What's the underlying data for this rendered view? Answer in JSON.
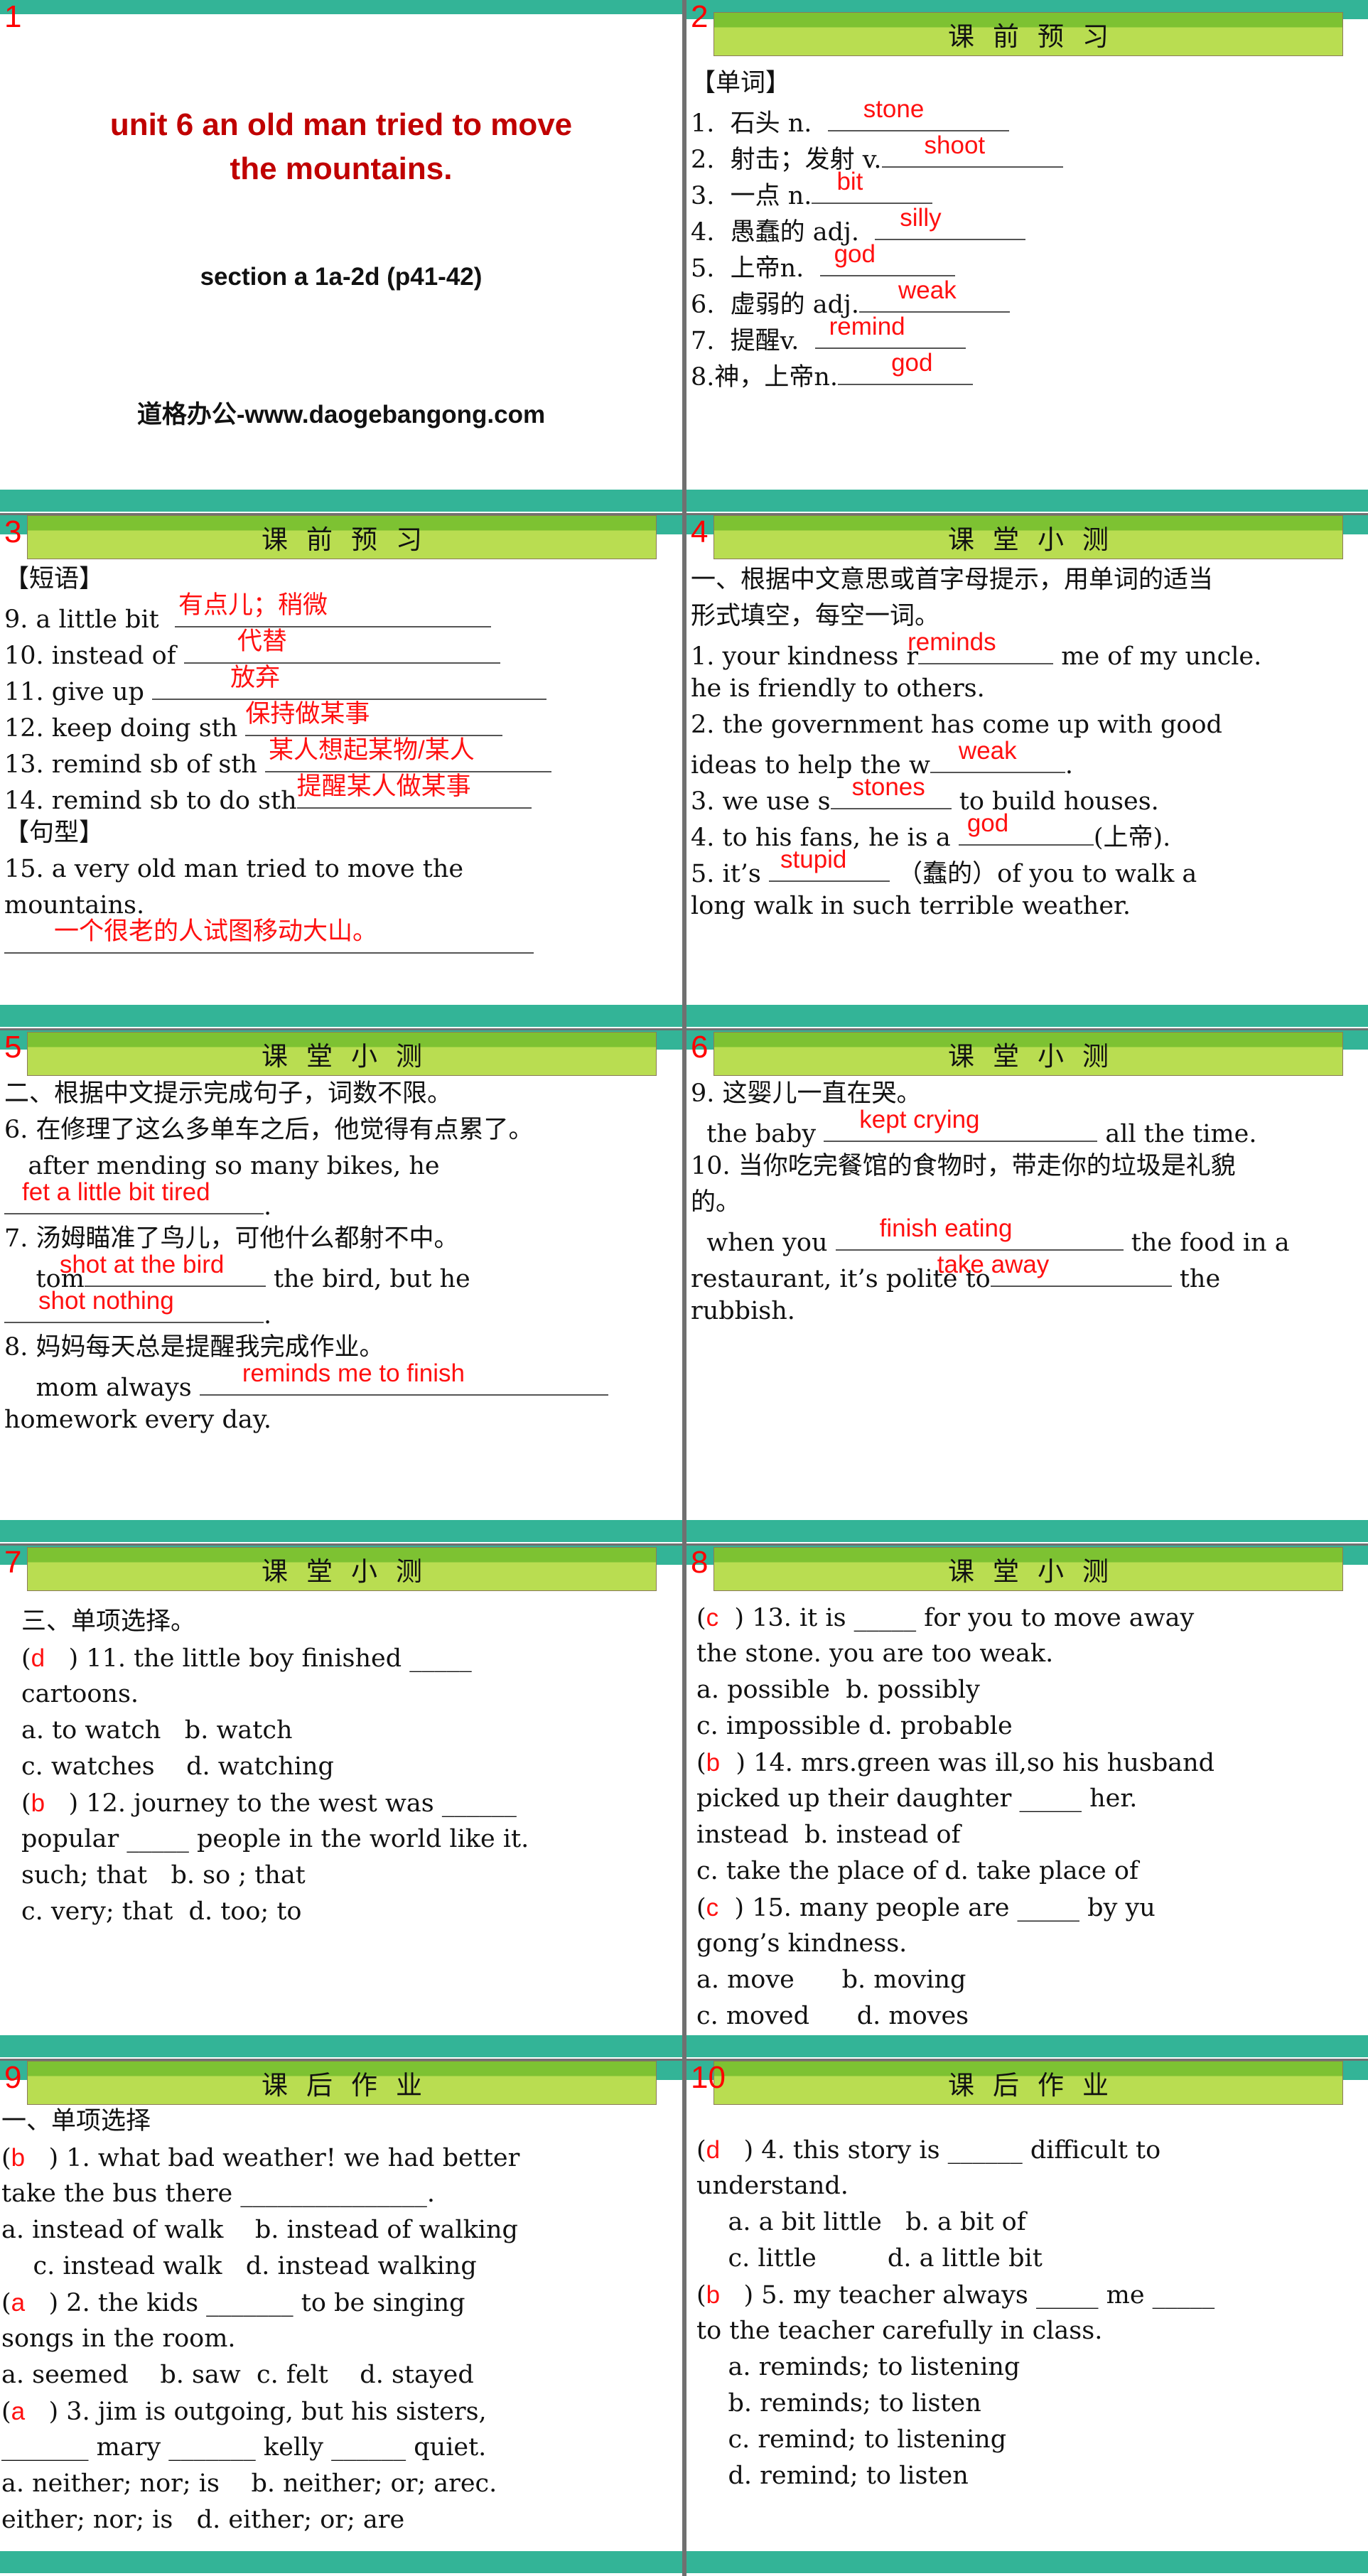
{
  "colors": {
    "teal": "#33b497",
    "green_dark": "#7dc232",
    "green_light": "#b9dd51",
    "answer_red": "#ff1010",
    "title_red": "#c00000",
    "divider_gray": "#707070"
  },
  "slides": [
    {
      "number": "1",
      "title_line1": "unit 6  an old man tried to move",
      "title_line2": "the mountains.",
      "subtitle": "section a 1a-2d (p41-42)",
      "site": "道格办公-www.daogebangong.com"
    },
    {
      "number": "2",
      "header": "课前预习",
      "section": "【单词】",
      "items": [
        {
          "prefix": "1.  石头 n.  ",
          "answer": "stone",
          "suffix": ""
        },
        {
          "prefix": "2.  射击；发射 v.",
          "answer": "shoot",
          "suffix": ""
        },
        {
          "prefix": "3.  一点 n.",
          "answer": "bit",
          "suffix": ""
        },
        {
          "prefix": "4.  愚蠢的 adj.  ",
          "answer": "silly",
          "suffix": ""
        },
        {
          "prefix": "5.  上帝n.  ",
          "answer": "god",
          "suffix": ""
        },
        {
          "prefix": "6.  虚弱的 adj.",
          "answer": "weak",
          "suffix": ""
        },
        {
          "prefix": "7.  提醒v.  ",
          "answer": "remind",
          "suffix": ""
        },
        {
          "prefix": "8.神，上帝n.",
          "answer": "god",
          "suffix": ""
        }
      ]
    },
    {
      "number": "3",
      "header": "课前预习",
      "section_phrases": "【短语】",
      "items": [
        {
          "prefix": "9. a little bit  ",
          "answer": "有点儿；稍微"
        },
        {
          "prefix": "10. instead of ",
          "answer": "代替"
        },
        {
          "prefix": "11. give up ",
          "answer": "放弃"
        },
        {
          "prefix": "12. keep doing sth ",
          "answer": "保持做某事"
        },
        {
          "prefix": "13. remind sb of sth ",
          "answer": "某人想起某物/某人"
        },
        {
          "prefix": "14. remind sb to do sth",
          "answer": "提醒某人做某事"
        }
      ],
      "section_sentence": "【句型】",
      "sentence_line1": "15. a very old man tried to move the",
      "sentence_line2": "mountains.",
      "sentence_answer": "一个很老的人试图移动大山。"
    },
    {
      "number": "4",
      "header": "课堂小测",
      "instruction_line1": "一、根据中文意思或首字母提示，用单词的适当",
      "instruction_line2": "形式填空，每空一词。",
      "q1_a": "1. your kindness r",
      "q1_answer": "reminds",
      "q1_b": " me of my uncle.",
      "q1_c": "he is friendly to others.",
      "q2_a": "2. the government has come up with good",
      "q2_b": "ideas to help the w",
      "q2_answer": "weak",
      "q2_c": ".",
      "q3_a": "3. we use s",
      "q3_answer": "stones",
      "q3_b": " to build houses.",
      "q4_a": "4. to his fans, he is a ",
      "q4_answer": "god",
      "q4_b": "(上帝).",
      "q5_a": "5. it’s ",
      "q5_answer": "stupid",
      "q5_b": " （蠢的）of you to walk a",
      "q5_c": "long walk in such terrible weather."
    },
    {
      "number": "5",
      "header": "课堂小测",
      "instruction": "二、根据中文提示完成句子，词数不限。",
      "q6_cn": "6. 在修理了这么多单车之后，他觉得有点累了。",
      "q6_en": "   after mending so many bikes, he",
      "q6_answer": "fet a little bit tired",
      "q6_end": ".",
      "q7_cn": "7. 汤姆瞄准了鸟儿，可他什么都射不中。",
      "q7_a": "    tom",
      "q7_answer1": "shot at the bird",
      "q7_b": " the bird, but he",
      "q7_answer2": "shot nothing",
      "q7_end": ".",
      "q8_cn": "8. 妈妈每天总是提醒我完成作业。",
      "q8_a": "    mom always ",
      "q8_answer": "reminds me to finish",
      "q8_b": "homework every day."
    },
    {
      "number": "6",
      "header": "课堂小测",
      "q9_cn": "9. 这婴儿一直在哭。",
      "q9_a": "  the baby ",
      "q9_answer": "kept crying",
      "q9_b": " all the time.",
      "q10_cn_line1": "10. 当你吃完餐馆的食物时，带走你的垃圾是礼貌",
      "q10_cn_line2": "的。",
      "q10_a": "  when you ",
      "q10_answer1": "finish eating",
      "q10_b": " the food in a",
      "q10_c": "restaurant, it’s polite to",
      "q10_answer2": "take away",
      "q10_d": " the",
      "q10_e": "rubbish."
    },
    {
      "number": "7",
      "header": "课堂小测",
      "instruction": "三、单项选择。",
      "questions": [
        {
          "answer": "d",
          "stem_line1": " ) 11. the little boy finished _____",
          "stem_line2": "cartoons.",
          "options_line1": "a. to watch   b. watch",
          "options_line2": "c. watches    d. watching"
        },
        {
          "answer": "b",
          "stem_line1": " ) 12. journey to the west was ______",
          "stem_line2": "popular _____ people in the world like it.",
          "options_line1": "such; that   b. so ; that",
          "options_line2": "c. very; that  d. too; to"
        }
      ]
    },
    {
      "number": "8",
      "header": "课堂小测",
      "questions": [
        {
          "answer": "c",
          "stem_line1": " ) 13. it is _____ for you to move away",
          "stem_line2": "the stone. you are too weak.",
          "options_line1": "a. possible  b. possibly",
          "options_line2": "c. impossible d. probable"
        },
        {
          "answer": "b",
          "stem_line1": " ) 14. mrs.green was ill,so his husband",
          "stem_line2": "picked up their daughter _____ her.",
          "options_line1": "instead  b. instead of",
          "options_line2": "c. take the place of d. take place of"
        },
        {
          "answer": "c",
          "stem_line1": " ) 15. many people are _____ by yu",
          "stem_line2": "gong’s kindness.",
          "options_line1": "a. move      b. moving",
          "options_line2": "c. moved      d. moves"
        }
      ]
    },
    {
      "number": "9",
      "header": "课后作业",
      "instruction": "一、单项选择",
      "lines": [
        {
          "answer": "b",
          "text": " ) 1. what bad weather! we had better"
        },
        {
          "answer": "",
          "text": "take the bus there _______________."
        },
        {
          "answer": "",
          "text": "a. instead of walk    b. instead of walking"
        },
        {
          "answer": "",
          "text": "    c. instead walk   d. instead walking"
        },
        {
          "answer": "a",
          "text": " ) 2. the kids _______ to be singing"
        },
        {
          "answer": "",
          "text": "songs in the room."
        },
        {
          "answer": "",
          "text": "a. seemed    b. saw  c. felt    d. stayed"
        },
        {
          "answer": "a",
          "text": " ) 3. jim is outgoing, but his sisters,"
        },
        {
          "answer": "",
          "text": "_______ mary _______ kelly ______ quiet."
        },
        {
          "answer": "",
          "text": "a. neither; nor; is    b. neither; or; arec."
        },
        {
          "answer": "",
          "text": "either; nor; is   d. either; or; are"
        }
      ]
    },
    {
      "number": "10",
      "header": "课后作业",
      "lines": [
        {
          "answer": "d",
          "text": " ) 4. this story is ______ difficult to"
        },
        {
          "answer": "",
          "text": "understand."
        },
        {
          "answer": "",
          "text": "    a. a bit little   b. a bit of"
        },
        {
          "answer": "",
          "text": "    c. little         d. a little bit"
        },
        {
          "answer": "b",
          "text": " ) 5. my teacher always _____ me _____"
        },
        {
          "answer": "",
          "text": "to the teacher carefully in class."
        },
        {
          "answer": "",
          "text": "    a. reminds; to listening"
        },
        {
          "answer": "",
          "text": "    b. reminds; to listen"
        },
        {
          "answer": "",
          "text": "    c. remind; to listening"
        },
        {
          "answer": "",
          "text": "    d. remind; to listen"
        }
      ]
    }
  ]
}
